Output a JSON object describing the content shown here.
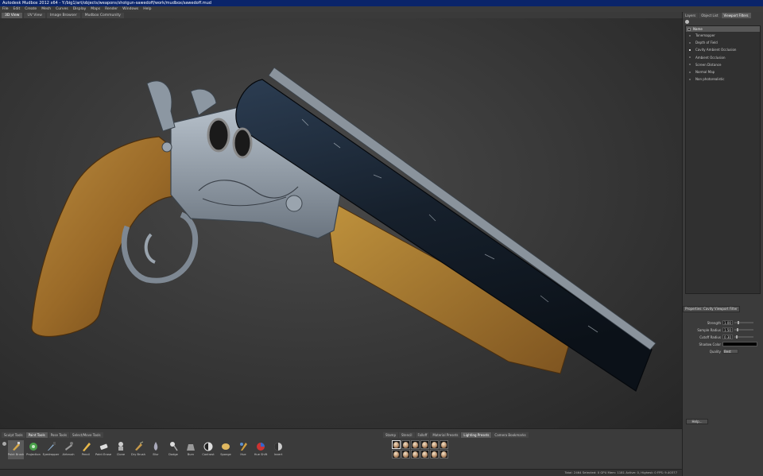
{
  "window": {
    "title": "Autodesk Mudbox 2012 x64 - Y:/big1/art/objects/weapons/shotgun-sawedoff/work/mudbox/sawedoff.mud"
  },
  "menu": [
    "File",
    "Edit",
    "Create",
    "Mesh",
    "Curves",
    "Display",
    "Maps",
    "Render",
    "Windows",
    "Help"
  ],
  "view_tabs": [
    "3D View",
    "UV View",
    "Image Browser",
    "Mudbox Community"
  ],
  "right_panel": {
    "tabs": [
      "Layers",
      "Object List",
      "Viewport Filters"
    ],
    "filter_header": "Name",
    "filters": [
      {
        "label": "Tonemapper",
        "on": false
      },
      {
        "label": "Depth of Field",
        "on": false
      },
      {
        "label": "Cavity Ambient Occlusion",
        "on": true
      },
      {
        "label": "Ambient Occlusion",
        "on": false
      },
      {
        "label": "Screen Distance",
        "on": false
      },
      {
        "label": "Normal Map",
        "on": false
      },
      {
        "label": "Non photorealistic",
        "on": false
      }
    ],
    "properties_button": "Properties: Cavity Viewport Filter",
    "props": {
      "strength_label": "Strength",
      "strength_value": "1.00",
      "sample_radius_label": "Sample Radius",
      "sample_radius_value": "1.50",
      "cutoff_radius_label": "Cutoff Radius",
      "cutoff_radius_value": "0.30",
      "shadow_color_label": "Shadow Color",
      "quality_label": "Quality",
      "quality_value": "Best"
    },
    "help_button": "Help..."
  },
  "bottom_tabs_left": [
    "Sculpt Tools",
    "Paint Tools",
    "Pose Tools",
    "Select/Move Tools"
  ],
  "bottom_tabs_left_active": 1,
  "tools": [
    {
      "label": "Paint Brush",
      "icon": "paint-brush-icon",
      "active": true
    },
    {
      "label": "Projection",
      "icon": "projection-icon"
    },
    {
      "label": "Eyedropper",
      "icon": "eyedropper-icon"
    },
    {
      "label": "Airbrush",
      "icon": "airbrush-icon"
    },
    {
      "label": "Pencil",
      "icon": "pencil-icon"
    },
    {
      "label": "Paint Erase",
      "icon": "eraser-icon"
    },
    {
      "label": "Clone",
      "icon": "clone-icon"
    },
    {
      "label": "Dry Brush",
      "icon": "dry-brush-icon"
    },
    {
      "label": "Blur",
      "icon": "blur-icon"
    },
    {
      "label": "Dodge",
      "icon": "dodge-icon"
    },
    {
      "label": "Burn",
      "icon": "burn-icon"
    },
    {
      "label": "Contrast",
      "icon": "contrast-icon"
    },
    {
      "label": "Sponge",
      "icon": "sponge-icon"
    },
    {
      "label": "Hue",
      "icon": "hue-icon"
    },
    {
      "label": "Hue Shift",
      "icon": "hue-shift-icon"
    },
    {
      "label": "Invert",
      "icon": "invert-icon"
    }
  ],
  "bottom_tabs_right": [
    "Stamp",
    "Stencil",
    "Falloff",
    "Material Presets",
    "Lighting Presets",
    "Camera Bookmarks"
  ],
  "bottom_tabs_right_active": 4,
  "stamp_count": 12,
  "status": "Total: 2464  Selected: 0  GPU Mem: 1181  Active: 0, Highest: 0  FPS: 9.40377",
  "colors": {
    "barrel": "#1b2735",
    "stock": "#a0712c",
    "metal": "#8f9aa6",
    "titlebar": "#0a246a"
  }
}
